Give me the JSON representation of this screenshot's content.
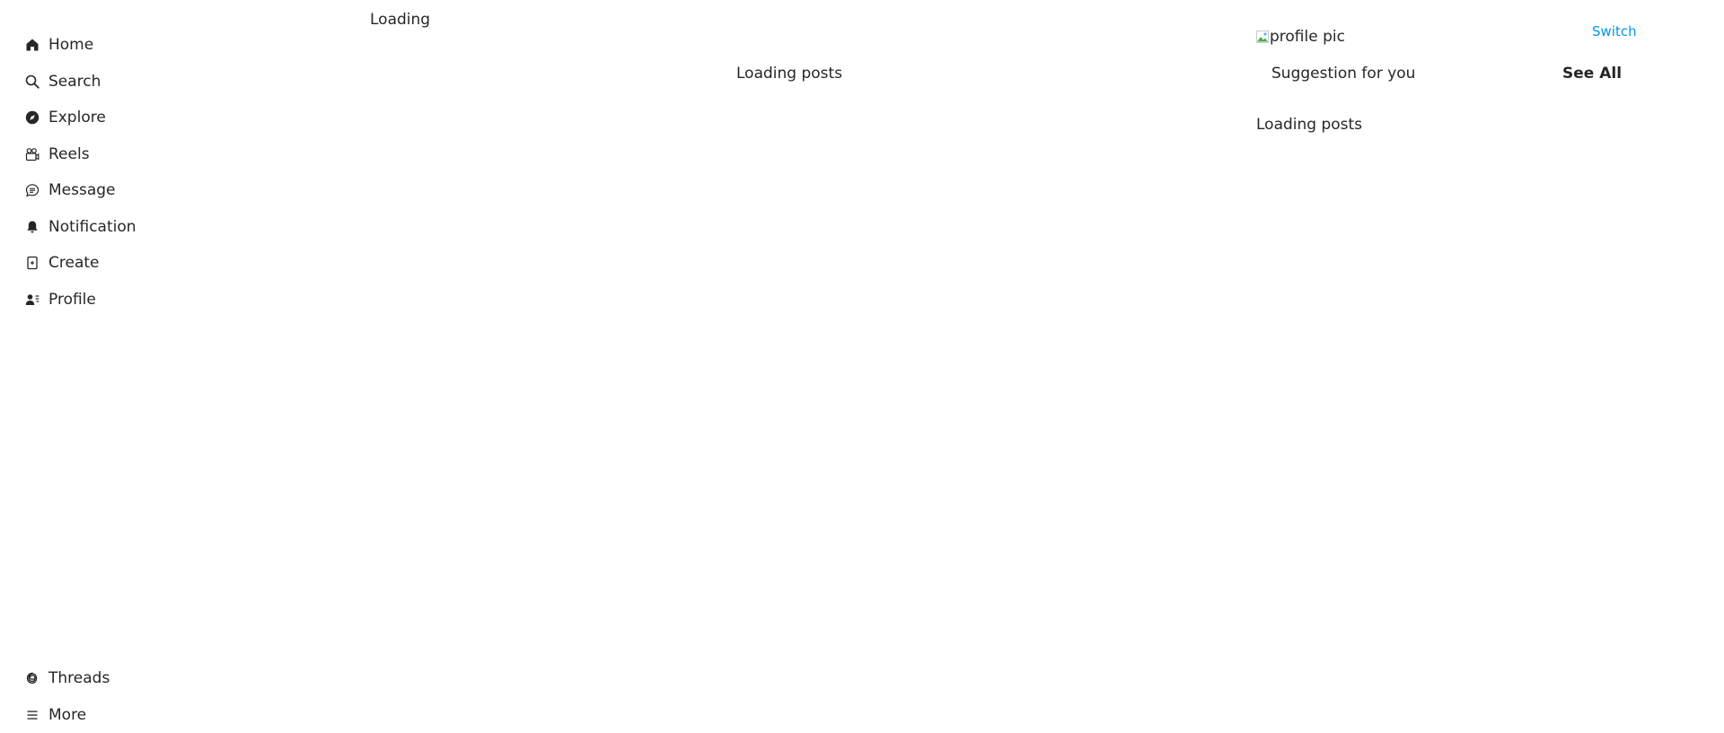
{
  "sidebar": {
    "items": [
      {
        "label": "Home",
        "icon": "home-icon"
      },
      {
        "label": "Search",
        "icon": "search-icon"
      },
      {
        "label": "Explore",
        "icon": "compass-icon"
      },
      {
        "label": "Reels",
        "icon": "reels-icon"
      },
      {
        "label": "Message",
        "icon": "message-icon"
      },
      {
        "label": "Notification",
        "icon": "bell-icon"
      },
      {
        "label": "Create",
        "icon": "create-icon"
      },
      {
        "label": "Profile",
        "icon": "profile-icon"
      }
    ],
    "bottom_items": [
      {
        "label": "Threads",
        "icon": "threads-icon"
      },
      {
        "label": "More",
        "icon": "menu-icon"
      }
    ]
  },
  "main": {
    "loading_text": "Loading",
    "feed_loading_text": "Loading posts"
  },
  "right_panel": {
    "profile_pic_alt": "profile pic",
    "switch_label": "Switch",
    "suggestion_title": "Suggestion for you",
    "see_all_label": "See All",
    "loading_text": "Loading posts"
  },
  "colors": {
    "text": "#262626",
    "link": "#0095f6",
    "background": "#ffffff"
  }
}
